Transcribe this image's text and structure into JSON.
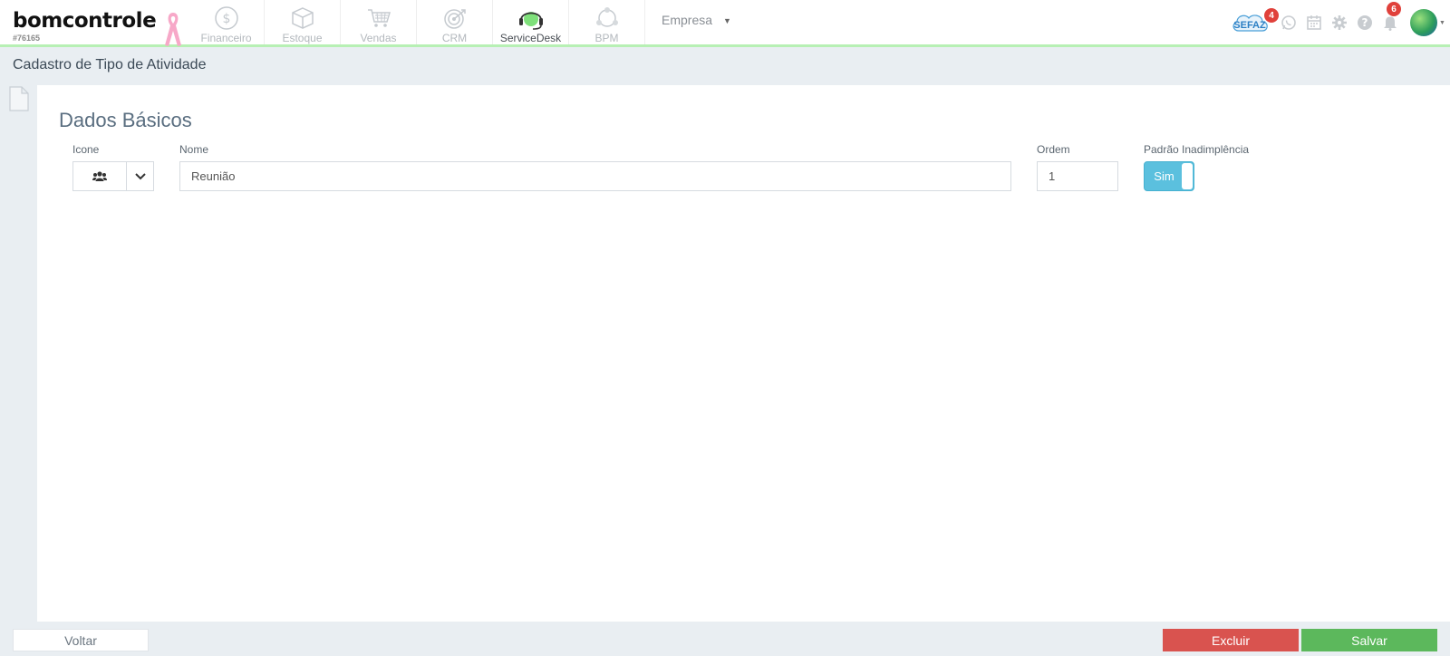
{
  "header": {
    "logo_text": "bomcontrole",
    "account_id": "#76165",
    "modules": [
      {
        "label": "Financeiro",
        "icon": "dollar-circle-icon",
        "active": false
      },
      {
        "label": "Estoque",
        "icon": "box-icon",
        "active": false
      },
      {
        "label": "Vendas",
        "icon": "cart-icon",
        "active": false
      },
      {
        "label": "CRM",
        "icon": "target-icon",
        "active": false
      },
      {
        "label": "ServiceDesk",
        "icon": "headset-icon",
        "active": true
      },
      {
        "label": "BPM",
        "icon": "workflow-icon",
        "active": false
      }
    ],
    "company_menu": "Empresa",
    "sefaz_label": "SEFAZ",
    "sefaz_badge": "4",
    "notifications_badge": "6",
    "colors": {
      "accent_line": "#b7f0b4",
      "badge": "#e0413b",
      "active_module": "#7ee07a"
    }
  },
  "page": {
    "title": "Cadastro de Tipo de Atividade",
    "section_title": "Dados Básicos"
  },
  "form": {
    "icone_label": "Icone",
    "icone_value": "users-icon",
    "nome_label": "Nome",
    "nome_value": "Reunião",
    "ordem_label": "Ordem",
    "ordem_value": "1",
    "padrao_label": "Padrão Inadimplência",
    "padrao_value": "Sim",
    "toggle_color": "#5bc0de"
  },
  "footer": {
    "back_label": "Voltar",
    "delete_label": "Excluir",
    "save_label": "Salvar",
    "delete_color": "#d9534f",
    "save_color": "#5cb85c"
  }
}
